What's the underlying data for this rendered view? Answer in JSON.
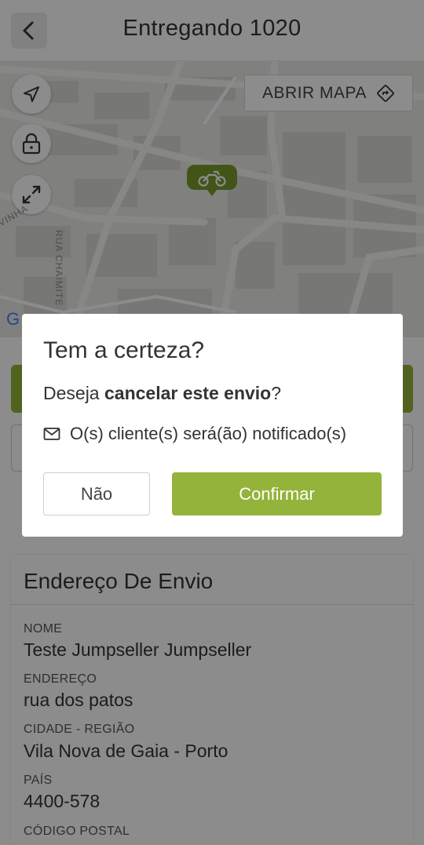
{
  "header": {
    "title": "Entregando 1020",
    "back_icon": "chevron-left-icon"
  },
  "map": {
    "open_map_label": "ABRIR MAPA",
    "open_map_icon": "directions-icon",
    "controls": [
      "navigation-arrow-icon",
      "lock-icon",
      "expand-icon"
    ],
    "marker_icon": "motorcycle-icon",
    "street_labels": [
      "RUA CHAIMITE",
      "VINHA"
    ],
    "provider_logo": "G",
    "marker_color": "#7a9a2e"
  },
  "shipping_card": {
    "title": "Endereço De Envio",
    "fields": [
      {
        "label": "NOME",
        "value": "Teste Jumpseller Jumpseller"
      },
      {
        "label": "ENDEREÇO",
        "value": "rua dos patos"
      },
      {
        "label": "CIDADE - REGIÃO",
        "value": "Vila Nova de Gaia - Porto"
      },
      {
        "label": "PAÍS",
        "value": "4400-578"
      },
      {
        "label": "CÓDIGO POSTAL",
        "value": ""
      }
    ]
  },
  "dialog": {
    "title": "Tem a certeza?",
    "message_prefix": "Deseja ",
    "message_bold": "cancelar este envio",
    "message_suffix": "?",
    "notice_icon": "envelope-icon",
    "notice": "O(s) cliente(s) será(ão) notificado(s)",
    "cancel_label": "Não",
    "confirm_label": "Confirmar"
  },
  "colors": {
    "accent": "#94b33a",
    "overlay": "rgba(0,0,0,0.45)"
  }
}
